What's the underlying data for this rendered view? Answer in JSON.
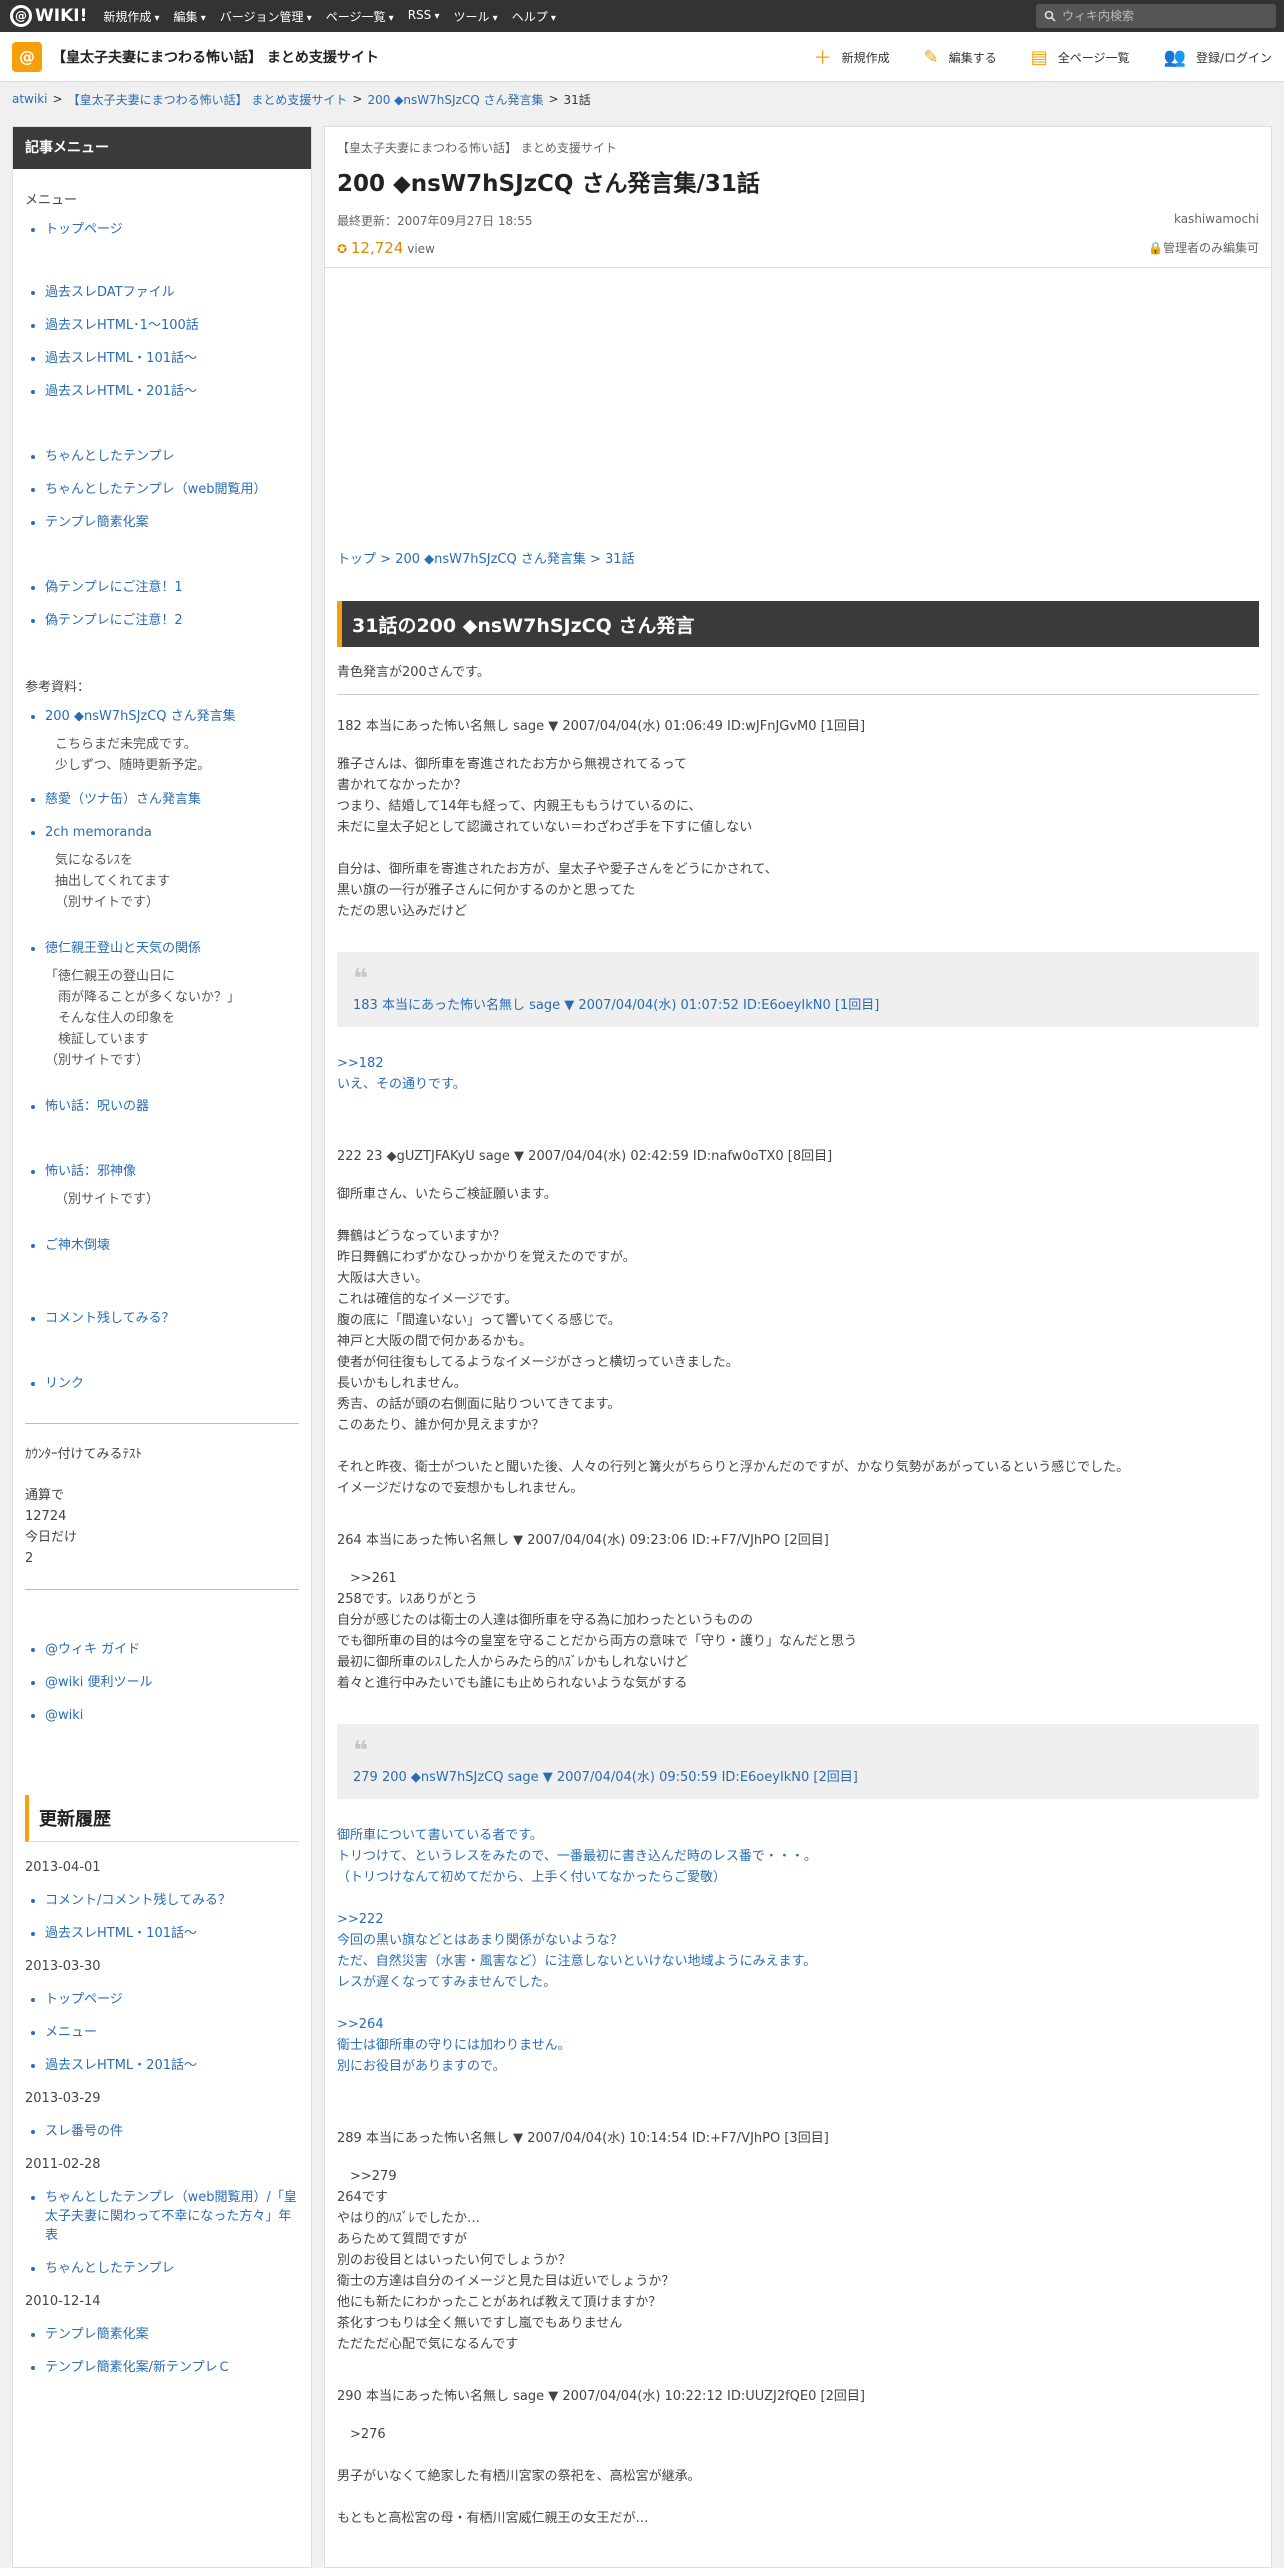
{
  "topbar": {
    "logo": "WIKI!",
    "nav": [
      "新規作成",
      "編集",
      "バージョン管理",
      "ページ一覧",
      "RSS",
      "ツール",
      "ヘルプ"
    ],
    "search_placeholder": "ウィキ内検索"
  },
  "site": {
    "title": "【皇太子夫妻にまつわる怖い話】 まとめ支援サイト",
    "actions": [
      "新規作成",
      "編集する",
      "全ページ一覧",
      "登録/ログイン"
    ]
  },
  "breadcrumb": [
    "atwiki",
    "【皇太子夫妻にまつわる怖い話】 まとめ支援サイト",
    "200 ◆nsW7hSJzCQ さん発言集",
    "31話"
  ],
  "sidebar": {
    "head": "記事メニュー",
    "menu_label": "メニュー",
    "group1": [
      "トップページ"
    ],
    "group2": [
      "過去スレDATファイル",
      "過去スレHTML･1～100話",
      "過去スレHTML・101話～",
      "過去スレHTML・201話～"
    ],
    "group3": [
      "ちゃんとしたテンプレ",
      "ちゃんとしたテンプレ（web閲覧用）",
      "テンプレ簡素化案"
    ],
    "group4": [
      "偽テンプレにご注意！1",
      "偽テンプレにご注意！2"
    ],
    "ref_label": "参考資料：",
    "ref1": "200 ◆nsW7hSJzCQ さん発言集",
    "ref1_note": "こちらまだ未完成です。\n少しずつ、随時更新予定。",
    "ref2": "慈愛（ツナ缶）さん発言集",
    "ref3": "2ch memoranda",
    "ref3_note": "気になるﾚｽを\n抽出してくれてます\n（別サイトです）",
    "ref4": "徳仁親王登山と天気の関係",
    "ref4_note": "「徳仁親王の登山日に\n　雨が降ることが多くないか？」\n　そんな住人の印象を\n　検証しています\n（別サイトです）",
    "ref5": "怖い話：呪いの器",
    "ref6": "怖い話：邪神像",
    "ref6_note": "（別サイトです）",
    "ref7": "ご神木倒壊",
    "ref8": "コメント残してみる？",
    "ref9": "リンク",
    "counter_label": "ｶｳﾝﾀｰ付けてみるﾃｽﾄ",
    "counter_total_label": "通算で",
    "counter_total": "12724",
    "counter_today_label": "今日だけ",
    "counter_today": "2",
    "tools": [
      "@ウィキ ガイド",
      "@wiki 便利ツール",
      "@wiki"
    ],
    "recent_head": "更新履歴",
    "recent": [
      {
        "date": "2013-04-01",
        "items": [
          "コメント/コメント残してみる？",
          "過去スレHTML・101話～"
        ]
      },
      {
        "date": "2013-03-30",
        "items": [
          "トップページ",
          "メニュー",
          "過去スレHTML・201話～"
        ]
      },
      {
        "date": "2013-03-29",
        "items": [
          "スレ番号の件"
        ]
      },
      {
        "date": "2011-02-28",
        "items": [
          "ちゃんとしたテンプレ（web閲覧用）/「皇太子夫妻に関わって不幸になった方々」年表",
          "ちゃんとしたテンプレ"
        ]
      },
      {
        "date": "2010-12-14",
        "items": [
          "テンプレ簡素化案",
          "テンプレ簡素化案/新テンプレＣ"
        ]
      }
    ]
  },
  "main": {
    "site_label": "【皇太子夫妻にまつわる怖い話】 まとめ支援サイト",
    "title": "200 ◆nsW7hSJzCQ さん発言集/31話",
    "updated": "最終更新：2007年09月27日 18:55",
    "author": "kashiwamochi",
    "views": "12,724",
    "views_unit": "view",
    "edit_perm": "管理者のみ編集可",
    "crumb": [
      "トップ",
      "200 ◆nsW7hSJzCQ さん発言集",
      "31話"
    ],
    "heading": "31話の200 ◆nsW7hSJzCQ さん発言",
    "intro": "青色発言が200さんです。",
    "post1_head": "182 本当にあった怖い名無し sage ▼ 2007/04/04(水) 01:06:49 ID:wJFnJGvM0 [1回目]",
    "post1_body": "雅子さんは、御所車を寄進されたお方から無視されてるって\n書かれてなかったか？\nつまり、結婚して14年も経って、内親王ももうけているのに、\n未だに皇太子妃として認識されていない＝わざわざ手を下すに値しない\n\n自分は、御所車を寄進されたお方が、皇太子や愛子さんをどうにかされて、\n黒い旗の一行が雅子さんに何かするのかと思ってた\nただの思い込みだけど",
    "quote1": "183 本当にあった怖い名無し sage ▼ 2007/04/04(水) 01:07:52 ID:E6oeyIkN0 [1回目]",
    "reply1": ">>182\nいえ、その通りです。",
    "post2_head": "222 23 ◆gUZTJFAKyU sage ▼ 2007/04/04(水) 02:42:59 ID:nafw0oTX0 [8回目]",
    "post2_body": "御所車さん、いたらご検証願います。\n\n舞鶴はどうなっていますか？\n昨日舞鶴にわずかなひっかかりを覚えたのですが。\n大阪は大きい。\nこれは確信的なイメージです。\n腹の底に「間違いない」って響いてくる感じで。\n神戸と大阪の間で何かあるかも。\n使者が何往復もしてるようなイメージがさっと横切っていきました。\n長いかもしれません。\n秀吉、の話が頭の右側面に貼りついてきてます。\nこのあたり、誰か何か見えますか？\n\nそれと昨夜、衛士がついたと聞いた後、人々の行列と篝火がちらりと浮かんだのですが、かなり気勢があがっているという感じでした。\nイメージだけなので妄想かもしれません。",
    "post3_head": "264 本当にあった怖い名無し ▼ 2007/04/04(水) 09:23:06 ID:+F7/VJhPO [2回目]",
    "post3_body": "　>>261\n258です。ﾚｽありがとう\n自分が感じたのは衛士の人達は御所車を守る為に加わったというものの\nでも御所車の目的は今の皇室を守ることだから両方の意味で「守り・護り」なんだと思う\n最初に御所車のﾚｽした人からみたら的ﾊｽﾞﾚかもしれないけど\n着々と進行中みたいでも誰にも止められないような気がする",
    "quote2": "279 200 ◆nsW7hSJzCQ sage ▼ 2007/04/04(水) 09:50:59 ID:E6oeyIkN0 [2回目]",
    "reply2": "御所車について書いている者です。\nトリつけて、というレスをみたので、一番最初に書き込んだ時のレス番で・・・。\n（トリつけなんて初めてだから、上手く付いてなかったらご愛敬）\n\n>>222\n今回の黒い旗などとはあまり関係がないような？\nただ、自然災害（水害・風害など）に注意しないといけない地域ようにみえます。\nレスが遅くなってすみませんでした。\n\n>>264\n衛士は御所車の守りには加わりません。\n別にお役目がありますので。",
    "post4_head": "289 本当にあった怖い名無し ▼ 2007/04/04(水) 10:14:54 ID:+F7/VJhPO [3回目]",
    "post4_body": "　>>279\n264です\nやはり的ﾊｽﾞﾚでしたか…\nあらためて質問ですが\n別のお役目とはいったい何でしょうか？\n衛士の方達は自分のイメージと見た目は近いでしょうか？\n他にも新たにわかったことがあれば教えて頂けますか？\n茶化すつもりは全く無いですし嵐でもありません\nただただ心配で気になるんです",
    "post5_head": "290 本当にあった怖い名無し sage ▼ 2007/04/04(水) 10:22:12 ID:UUZJ2fQE0 [2回目]",
    "post5_body": "　>276\n\n男子がいなくて絶家した有栖川宮家の祭祀を、高松宮が継承。\n\nもともと高松宮の母・有栖川宮威仁親王の女王だが…"
  },
  "colors": {
    "accent": "#f5a00a",
    "link": "#2a6db5",
    "dark": "#333333"
  }
}
